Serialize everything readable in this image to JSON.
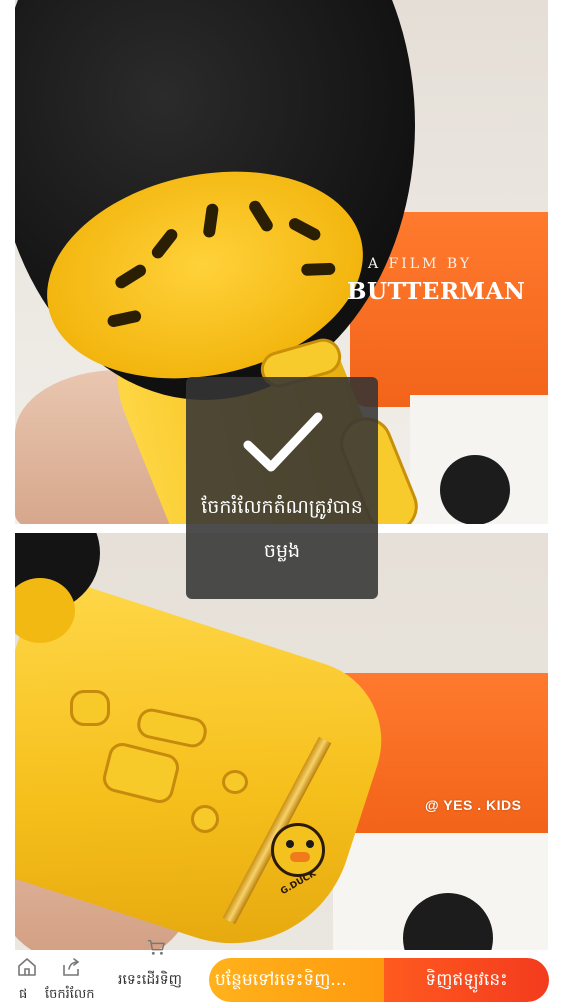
{
  "photos": {
    "first": {
      "credit_line1": "A FILM BY",
      "credit_line2": "BUTTERMAN"
    },
    "second": {
      "watermark": "@ YES . KIDS",
      "duck_brand": "G.DUCK"
    }
  },
  "toast": {
    "icon": "checkmark-icon",
    "message": "ចែករំលែកតំណត្រូវបានចម្លង"
  },
  "bottom_bar": {
    "home": {
      "icon": "home-icon",
      "label": "ផ"
    },
    "share": {
      "icon": "share-icon",
      "label": "ចែករំលែក"
    },
    "cart": {
      "icon": "cart-icon",
      "label": "រទេះដើរទិញ"
    },
    "add_to_cart_label": "បន្ថែមទៅរទេះទិញ...",
    "buy_now_label": "ទិញឥឡូវនេះ",
    "colors": {
      "add_to_cart": "#ffa514",
      "buy_now": "#f5441e"
    }
  }
}
